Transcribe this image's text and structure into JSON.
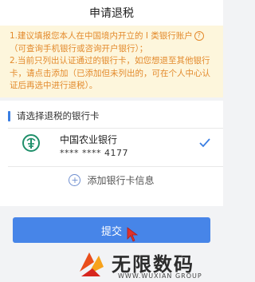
{
  "header": {
    "title": "申请退税"
  },
  "notice": {
    "line1_before_icon": "1.建议填报您本人在中国境内开立的 I 类银行账户",
    "help_icon": "?",
    "line1_after_icon": "（可查询手机银行或咨询开户银行）；",
    "line2": "2.当前只列出认证通过的银行卡，如您想退至其他银行卡，请点击添加（已添加但未列出的，可在个人中心认证后再选中进行退税）。"
  },
  "card_section": {
    "title": "请选择退税的银行卡",
    "bank": {
      "name": "中国农业银行",
      "number": "**** **** 4177",
      "logo_icon": "abc-bank-logo-icon",
      "selected": true
    },
    "add_label": "添加银行卡信息"
  },
  "submit": {
    "label": "提交"
  },
  "watermark": {
    "text": "无限数码",
    "sub": "WWW.WUXIAN GROUP"
  },
  "colors": {
    "accent": "#4785e8",
    "notice_bg": "#fdf6dc",
    "notice_text": "#e38a2c",
    "bank_green": "#1f8f6a"
  }
}
